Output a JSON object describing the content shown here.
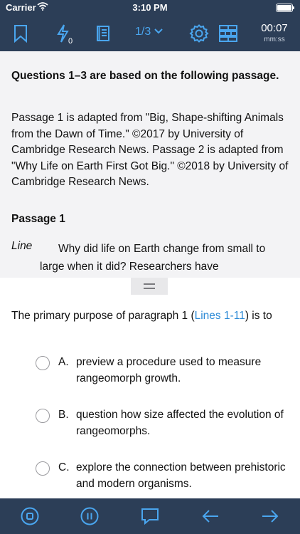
{
  "status_bar": {
    "carrier": "Carrier",
    "time": "3:10 PM",
    "wifi_icon": "wifi-icon",
    "battery_icon": "battery-icon"
  },
  "toolbar": {
    "bookmark_icon": "bookmark-icon",
    "bolt_icon": "bolt-icon",
    "bolt_count": "0",
    "notes_icon": "book-icon",
    "question_counter": "1/3",
    "settings_icon": "gear-icon",
    "grid_icon": "grid-icon",
    "timer_value": "00:07",
    "timer_unit": "mm:ss"
  },
  "passage": {
    "heading": "Questions 1–3 are based on the following passage.",
    "source": "Passage 1 is adapted from \"Big, Shape-shifting Animals from the Dawn of Time.\"  ©2017 by University of Cambridge Research News.  Passage 2 is adapted from \"Why Life on Earth First Got Big.\" ©2018 by University of Cambridge Research News.",
    "title": "Passage 1",
    "line_label": "Line",
    "body": "Why did life on Earth change from small to large when it did?  Researchers have"
  },
  "question": {
    "prefix": "The primary purpose of paragraph 1 (",
    "link": "Lines 1-11",
    "suffix": ") is to"
  },
  "choices": [
    {
      "letter": "A.",
      "text": "preview a procedure used to measure rangeomorph growth."
    },
    {
      "letter": "B.",
      "text": "question how size affected the evolution of rangeomorphs."
    },
    {
      "letter": "C.",
      "text": "explore the connection between prehistoric and modern organisms."
    }
  ],
  "bottom_bar": {
    "stop_icon": "stop-circle-icon",
    "pause_icon": "pause-circle-icon",
    "comment_icon": "comment-icon",
    "back_icon": "arrow-left-icon",
    "forward_icon": "arrow-right-icon"
  },
  "colors": {
    "bar_bg": "#2c3e57",
    "accent": "#4aa6ef",
    "link": "#2c8ad6",
    "passage_bg": "#f3f3f5"
  }
}
